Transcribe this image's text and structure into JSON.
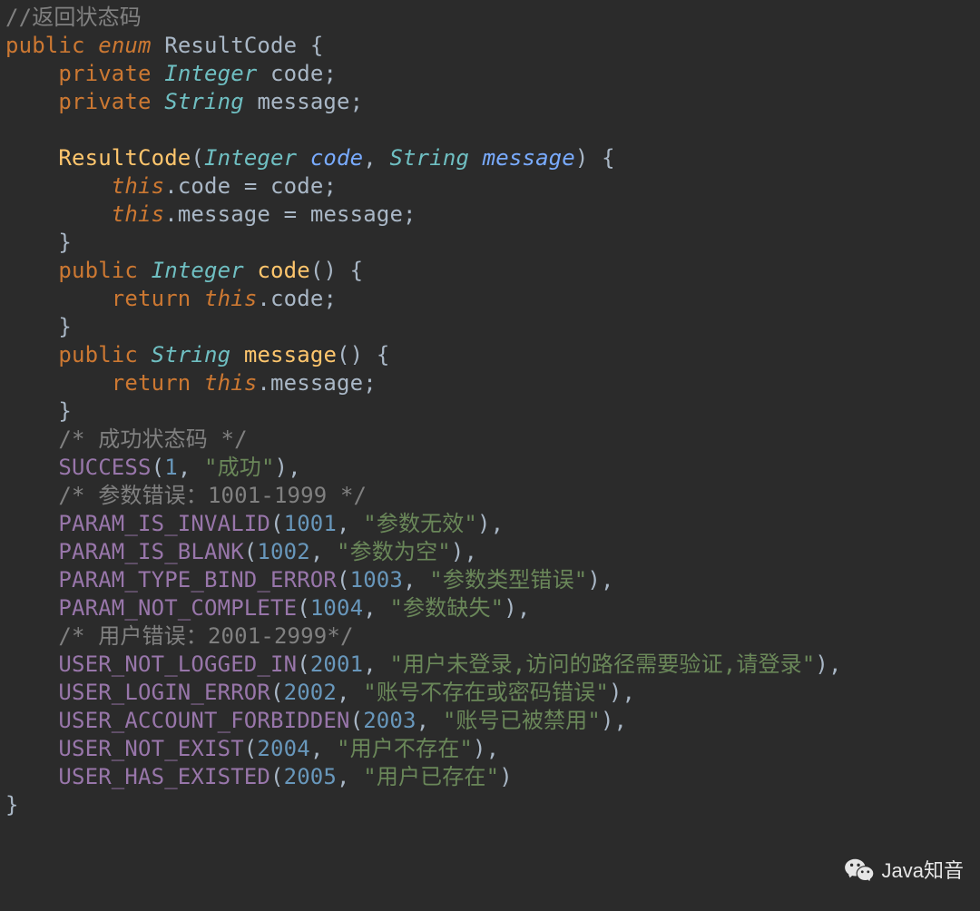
{
  "code": {
    "comment_top": "//返回状态码",
    "kw_public": "public",
    "kw_enum": "enum",
    "class_name": "ResultCode",
    "kw_private": "private",
    "type_integer": "Integer",
    "type_string": "String",
    "field_code": "code",
    "field_message": "message",
    "ctor_name": "ResultCode",
    "param_code": "code",
    "param_message": "message",
    "kw_this": "this",
    "kw_return": "return",
    "method_code": "code",
    "method_message": "message",
    "comment_success": "/* 成功状态码 */",
    "enum_success": "SUCCESS",
    "num_1": "1",
    "str_success": "\"成功\"",
    "comment_param": "/* 参数错误：1001-1999 */",
    "enum_param_invalid": "PARAM_IS_INVALID",
    "num_1001": "1001",
    "str_param_invalid": "\"参数无效\"",
    "enum_param_blank": "PARAM_IS_BLANK",
    "num_1002": "1002",
    "str_param_blank": "\"参数为空\"",
    "enum_param_type_bind": "PARAM_TYPE_BIND_ERROR",
    "num_1003": "1003",
    "str_param_type_bind": "\"参数类型错误\"",
    "enum_param_not_complete": "PARAM_NOT_COMPLETE",
    "num_1004": "1004",
    "str_param_not_complete": "\"参数缺失\"",
    "comment_user": "/* 用户错误：2001-2999*/",
    "enum_user_not_logged": "USER_NOT_LOGGED_IN",
    "num_2001": "2001",
    "str_user_not_logged": "\"用户未登录,访问的路径需要验证,请登录\"",
    "enum_user_login_error": "USER_LOGIN_ERROR",
    "num_2002": "2002",
    "str_user_login_error": "\"账号不存在或密码错误\"",
    "enum_user_forbidden": "USER_ACCOUNT_FORBIDDEN",
    "num_2003": "2003",
    "str_user_forbidden": "\"账号已被禁用\"",
    "enum_user_not_exist": "USER_NOT_EXIST",
    "num_2004": "2004",
    "str_user_not_exist": "\"用户不存在\"",
    "enum_user_has_existed": "USER_HAS_EXISTED",
    "num_2005": "2005",
    "str_user_has_existed": "\"用户已存在\""
  },
  "watermark": {
    "text": "Java知音"
  }
}
